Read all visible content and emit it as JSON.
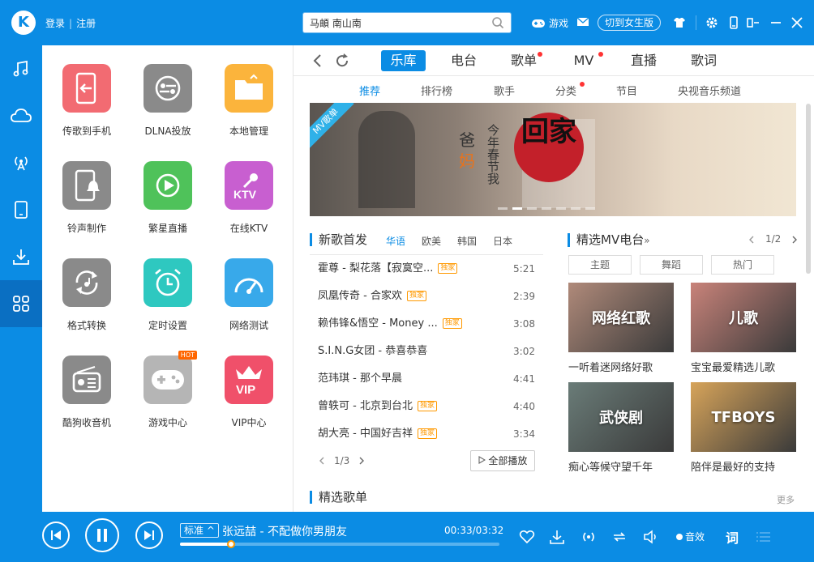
{
  "titlebar": {
    "logo": "K",
    "login": "登录",
    "register": "注册",
    "search_value": "马頔 南山南",
    "game": "游戏",
    "switch_mode": "切到女生版"
  },
  "tools": [
    {
      "label": "传歌到手机",
      "color": "#f26b72",
      "icon": "phone-transfer-icon"
    },
    {
      "label": "DLNA投放",
      "color": "#8a8a8a",
      "icon": "dlna-icon"
    },
    {
      "label": "本地管理",
      "color": "#fbb43c",
      "icon": "folder-icon"
    },
    {
      "label": "铃声制作",
      "color": "#8a8a8a",
      "icon": "ringtone-icon"
    },
    {
      "label": "繁星直播",
      "color": "#4fc25a",
      "icon": "live-play-icon"
    },
    {
      "label": "在线KTV",
      "color": "#c85fd0",
      "icon": "ktv-icon"
    },
    {
      "label": "格式转换",
      "color": "#8a8a8a",
      "icon": "format-convert-icon"
    },
    {
      "label": "定时设置",
      "color": "#2ec8c0",
      "icon": "alarm-clock-icon"
    },
    {
      "label": "网络测试",
      "color": "#38a9ea",
      "icon": "speed-gauge-icon"
    },
    {
      "label": "酷狗收音机",
      "color": "#8a8a8a",
      "icon": "radio-icon"
    },
    {
      "label": "游戏中心",
      "color": "#b5b5b5",
      "icon": "gamepad-icon",
      "badge": "HOT"
    },
    {
      "label": "VIP中心",
      "color": "#f0506a",
      "icon": "vip-crown-icon"
    }
  ],
  "topnav": {
    "tabs": [
      "乐库",
      "电台",
      "歌单",
      "MV",
      "直播",
      "歌词"
    ],
    "subtabs": [
      "推荐",
      "排行榜",
      "歌手",
      "分类",
      "节目",
      "央视音乐频道"
    ]
  },
  "banner": {
    "ribbon": "MV歌单",
    "line1": "爸",
    "line2": "妈",
    "line3": "今年春节我",
    "big": "回家"
  },
  "new_songs": {
    "title": "新歌首发",
    "langs": [
      "华语",
      "欧美",
      "韩国",
      "日本"
    ],
    "items": [
      {
        "name": "霍尊 - 梨花落【寂寞空...",
        "badge": "独家",
        "dur": "5:21"
      },
      {
        "name": "凤凰传奇 - 合家欢",
        "badge": "独家",
        "dur": "2:39"
      },
      {
        "name": "赖伟锋&悟空 - Money ...",
        "badge": "独家",
        "dur": "3:08"
      },
      {
        "name": "S.I.N.G女团 - 恭喜恭喜",
        "badge": "",
        "dur": "3:02"
      },
      {
        "name": "范玮琪 - 那个早晨",
        "badge": "",
        "dur": "4:41"
      },
      {
        "name": "曾轶可 - 北京到台北",
        "badge": "独家",
        "dur": "4:40"
      },
      {
        "name": "胡大亮 - 中国好吉祥",
        "badge": "独家",
        "dur": "3:34"
      }
    ],
    "page": "1/3",
    "play_all": "全部播放"
  },
  "mv_radio": {
    "title": "精选MV电台",
    "page": "1/2",
    "tags": [
      "主题",
      "舞蹈",
      "热门"
    ],
    "cards": [
      {
        "overlay": "网络红歌",
        "caption": "一听着迷网络好歌",
        "color": "#b08a7a"
      },
      {
        "overlay": "儿歌",
        "caption": "宝宝最爱精选儿歌",
        "color": "#c9837a"
      },
      {
        "overlay": "武侠剧",
        "caption": "痴心等候守望千年",
        "color": "#6a7c78"
      },
      {
        "overlay": "TFBOYS",
        "caption": "陪伴是最好的支持",
        "color": "#d7a45a"
      }
    ]
  },
  "playlists": {
    "title": "精选歌单",
    "more": "更多"
  },
  "player": {
    "quality": "标准",
    "now_playing": "张远喆 - 不配做你男朋友",
    "time": "00:33/03:32",
    "progress": 0.16,
    "effect": "音效",
    "lyric": "词"
  }
}
